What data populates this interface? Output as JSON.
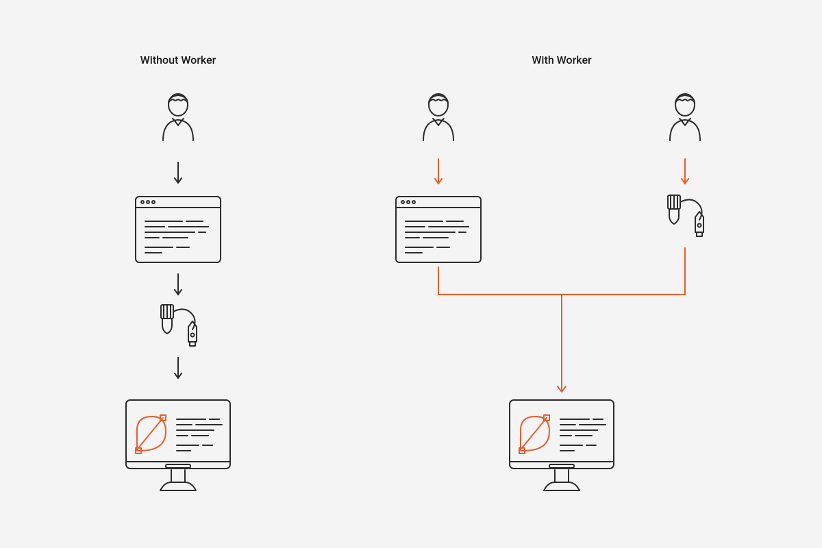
{
  "diagram": {
    "left_title": "Without Worker",
    "right_title": "With Worker",
    "colors": {
      "line": "#2b2b2b",
      "accent": "#e85d2f",
      "bg": "#f4f4f4"
    },
    "left_column": {
      "nodes": [
        "person",
        "code-window",
        "design-tools",
        "computer-output"
      ],
      "flow": "sequential"
    },
    "right_column": {
      "branches": [
        {
          "nodes": [
            "person",
            "code-window"
          ]
        },
        {
          "nodes": [
            "person",
            "design-tools"
          ]
        }
      ],
      "merge_to": "computer-output"
    }
  }
}
